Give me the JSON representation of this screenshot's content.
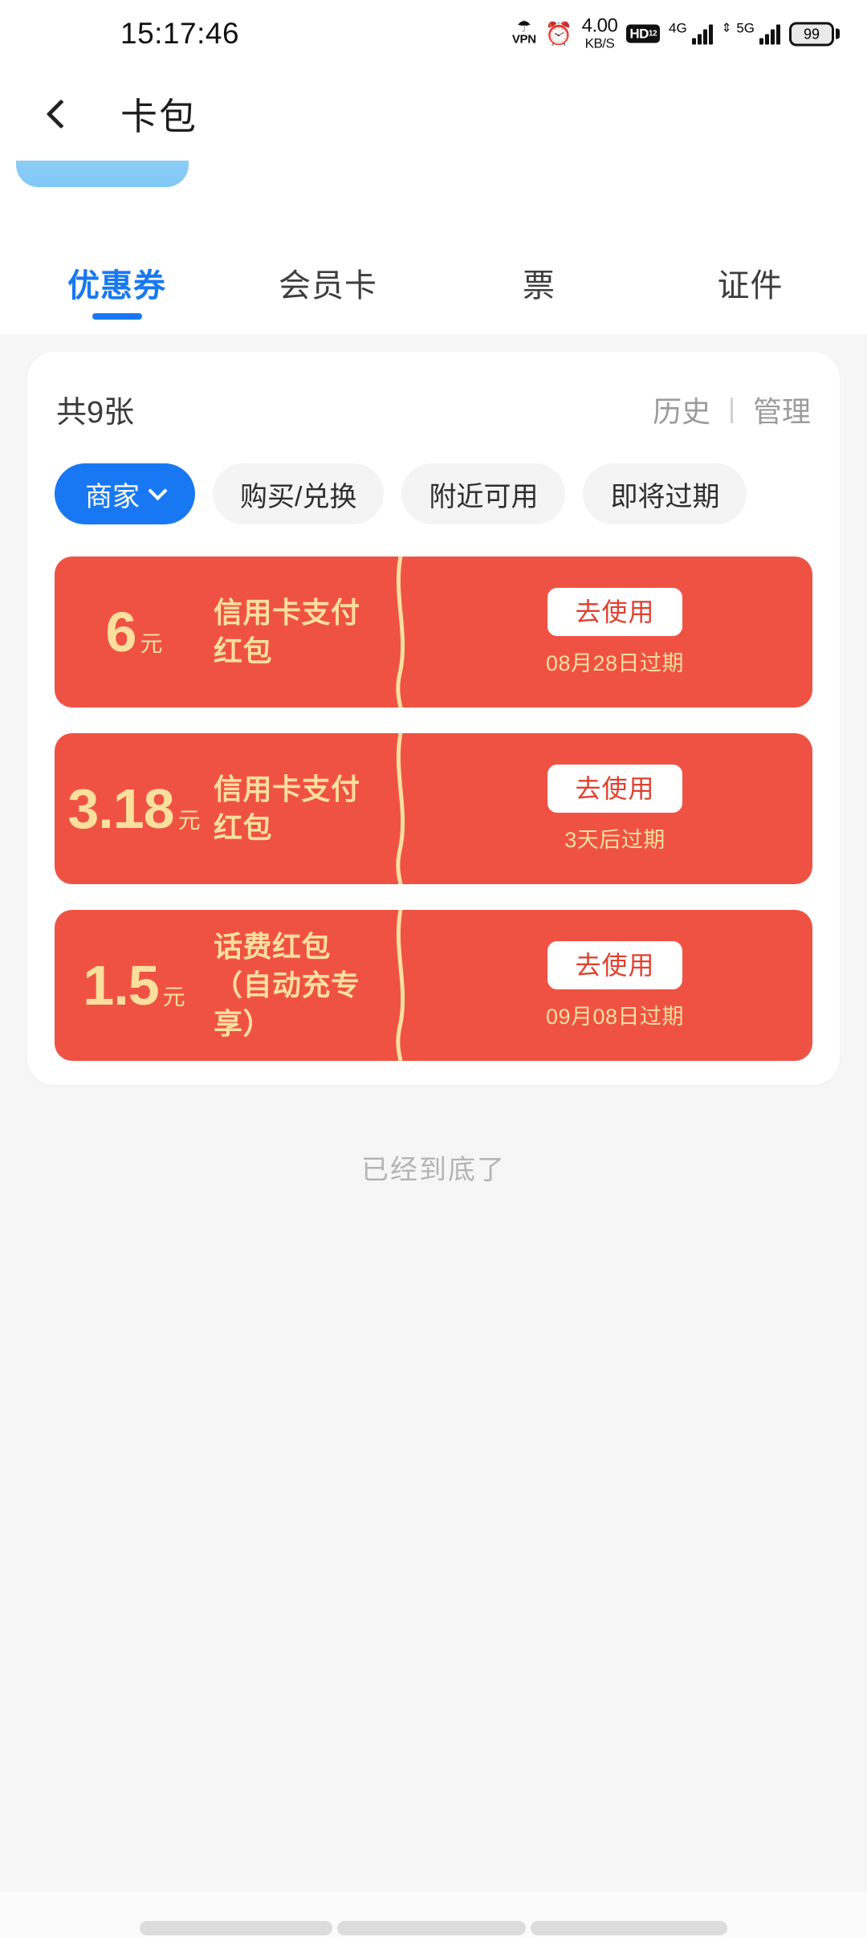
{
  "status_bar": {
    "time": "15:17:46",
    "vpn_label": "VPN",
    "network_speed_value": "4.00",
    "network_speed_unit": "KB/S",
    "hd_badge": "HD",
    "hd_sup": "1",
    "hd_sub": "2",
    "signal_1_label": "4G",
    "signal_2_label": "5G",
    "battery_percent": "99"
  },
  "header": {
    "title": "卡包",
    "back_icon": "chevron-left-icon"
  },
  "tabs": [
    {
      "label": "优惠券",
      "active": true
    },
    {
      "label": "会员卡",
      "active": false
    },
    {
      "label": "票",
      "active": false
    },
    {
      "label": "证件",
      "active": false
    }
  ],
  "panel": {
    "count_text": "共9张",
    "history_label": "历史",
    "separator": "|",
    "manage_label": "管理"
  },
  "filters": [
    {
      "label": "商家",
      "active": true,
      "has_caret": true
    },
    {
      "label": "购买/兑换",
      "active": false,
      "has_caret": false
    },
    {
      "label": "附近可用",
      "active": false,
      "has_caret": false
    },
    {
      "label": "即将过期",
      "active": false,
      "has_caret": false
    }
  ],
  "coupons": [
    {
      "amount": "6",
      "unit": "元",
      "title": "信用卡支付红包",
      "action_label": "去使用",
      "expiry": "08月28日过期"
    },
    {
      "amount": "3.18",
      "unit": "元",
      "title": "信用卡支付红包",
      "action_label": "去使用",
      "expiry": "3天后过期"
    },
    {
      "amount": "1.5",
      "unit": "元",
      "title": "话费红包（自动充专享）",
      "action_label": "去使用",
      "expiry": "09月08日过期"
    }
  ],
  "list_end_text": "已经到底了",
  "colors": {
    "accent_blue": "#1878f3",
    "coupon_red": "#ef5243",
    "coupon_gold": "#fadf9d",
    "page_bg": "#f6f6f6",
    "banner_blue": "#7fc8f6"
  }
}
